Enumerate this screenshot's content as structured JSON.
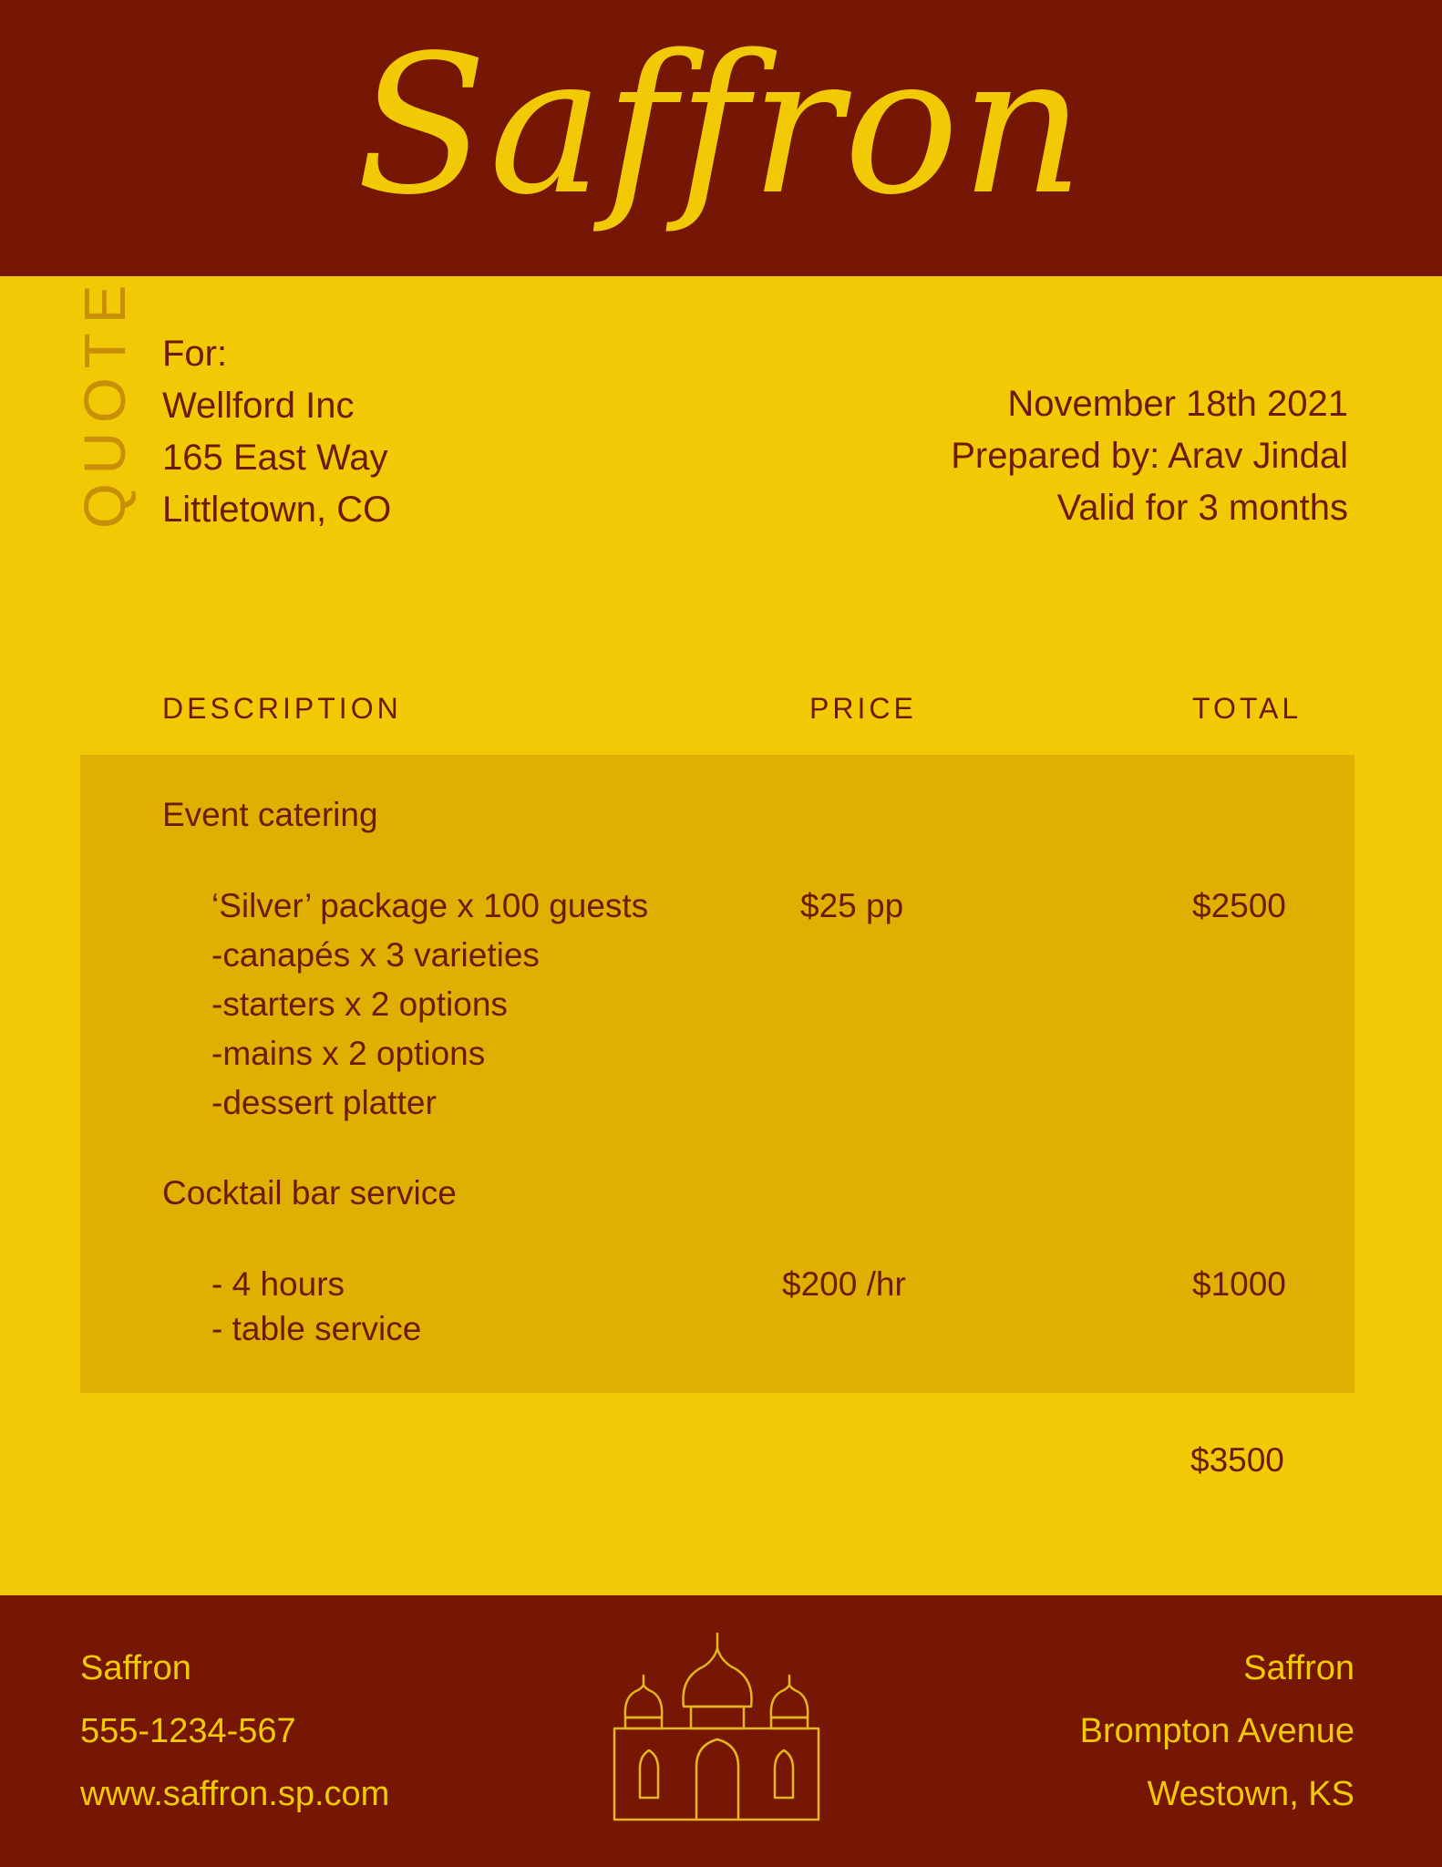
{
  "header": {
    "brand": "Saffron"
  },
  "quote_label": "QUOTE",
  "client": {
    "for_label": "For:",
    "name": "Wellford Inc",
    "street": "165 East Way",
    "city": "Littletown, CO"
  },
  "meta": {
    "date": "November 18th 2021",
    "prepared_by": "Prepared by: Arav Jindal",
    "validity": "Valid for 3 months"
  },
  "table": {
    "headers": {
      "description": "DESCRIPTION",
      "price": "PRICE",
      "total": "TOTAL"
    },
    "items": [
      {
        "title": "Event catering",
        "main_line": "‘Silver’ package x 100 guests",
        "details": [
          "-canapés x 3 varieties",
          "-starters x 2 options",
          "-mains x 2 options",
          "-dessert platter"
        ],
        "price": "$25 pp",
        "total": "$2500"
      },
      {
        "title": "Cocktail bar service",
        "main_line": "- 4 hours",
        "details": [
          "- table service"
        ],
        "price": "$200 /hr",
        "total": "$1000"
      }
    ],
    "grand_total": "$3500"
  },
  "footer": {
    "left": {
      "name": "Saffron",
      "phone": "555-1234-567",
      "website": "www.saffron.sp.com"
    },
    "right": {
      "name": "Saffron",
      "street": "Brompton Avenue",
      "city": "Westown, KS"
    },
    "icon": "palace-icon"
  },
  "colors": {
    "maroon": "#761604",
    "yellow": "#F2C905",
    "panel": "#DFAF02",
    "text": "#6E1A08"
  }
}
